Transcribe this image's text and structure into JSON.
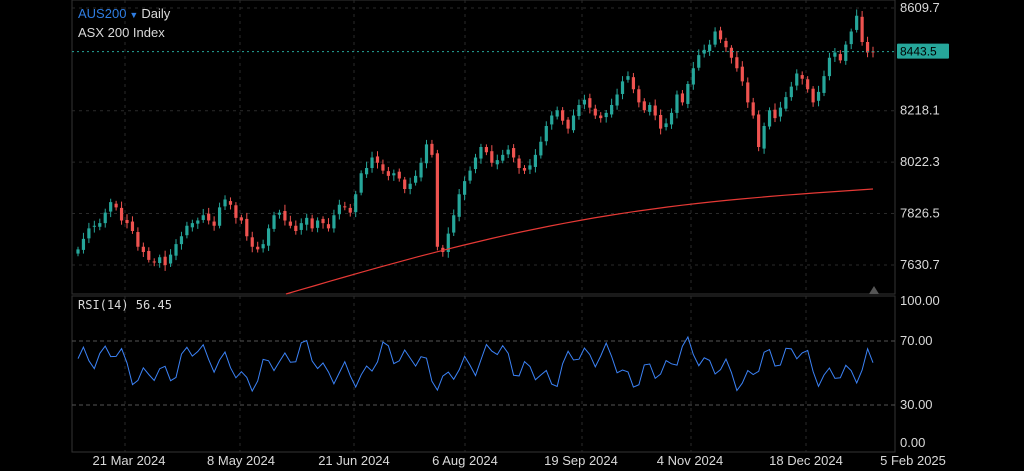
{
  "header": {
    "symbol": "AUS200",
    "dropdown_icon": "caret-down-icon",
    "timeframe": "Daily",
    "instrument": "ASX 200 Index"
  },
  "colors": {
    "background": "#000000",
    "grid": "#2a2a2a",
    "up_candle": "#26a69a",
    "down_candle": "#ef5350",
    "moving_average": "#e53935",
    "rsi_line": "#3b82f6",
    "price_tag": "#26a69a",
    "symbol": "#2f7de1"
  },
  "indicator": {
    "label": "RSI(14) 56.45"
  },
  "chart_data": [
    {
      "type": "candlestick",
      "x_tick_labels": [
        "21 Mar 2024",
        "8 May 2024",
        "21 Jun 2024",
        "6 Aug 2024",
        "19 Sep 2024",
        "4 Nov 2024",
        "18 Dec 2024",
        "5 Feb 2025"
      ],
      "y_tick_labels": [
        "8609.7",
        "8218.1",
        "8022.3",
        "7826.5",
        "7630.7"
      ],
      "ylim": [
        7520,
        8640
      ],
      "current_price": 8443.5,
      "grid": true,
      "series": [
        {
          "name": "",
          "kind": "ohlc",
          "values": []
        },
        {
          "name": "",
          "kind": "moving_average",
          "values": []
        }
      ]
    },
    {
      "type": "line",
      "label": "RSI(14) 56.45",
      "y_tick_labels": [
        "100.00",
        "70.00",
        "30.00",
        "0.00"
      ],
      "ylim": [
        0,
        100
      ],
      "reference_lines": [
        70,
        30
      ],
      "current_value": 56.45,
      "grid": true,
      "series": [
        {
          "name": "",
          "values": []
        }
      ]
    }
  ]
}
